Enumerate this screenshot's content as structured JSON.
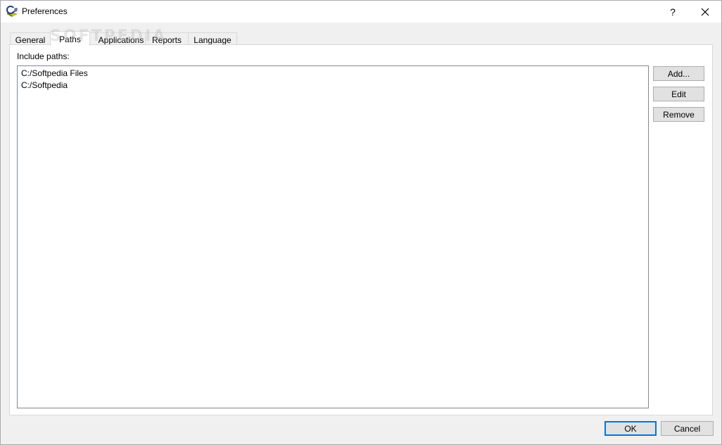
{
  "window": {
    "title": "Preferences",
    "help_label": "?",
    "close_label": "✕"
  },
  "tabs": [
    {
      "label": "General",
      "active": false
    },
    {
      "label": "Paths",
      "active": true
    },
    {
      "label": "Applications",
      "active": false
    },
    {
      "label": "Reports",
      "active": false
    },
    {
      "label": "Language",
      "active": false
    }
  ],
  "paths_panel": {
    "include_label": "Include paths:",
    "items": [
      "C:/Softpedia Files",
      "C:/Softpedia"
    ],
    "add_label": "Add...",
    "edit_label": "Edit",
    "remove_label": "Remove"
  },
  "footer": {
    "ok_label": "OK",
    "cancel_label": "Cancel"
  },
  "watermark": "SOFTPEDIA",
  "colors": {
    "accent": "#0078d7",
    "button_face": "#e1e1e1",
    "window_bg": "#f0f0f0"
  }
}
